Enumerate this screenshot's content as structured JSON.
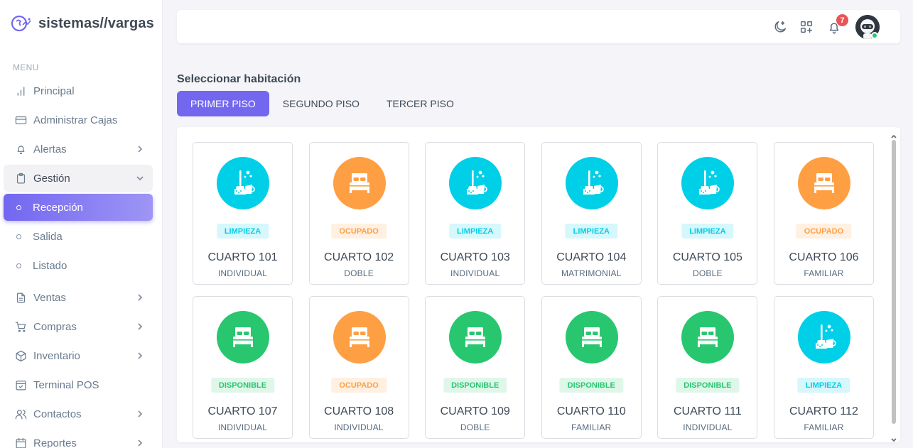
{
  "brand": {
    "name": "sistemas//vargas"
  },
  "sidebar": {
    "header": "MENU",
    "items": [
      {
        "label": "Principal",
        "icon": "bar-chart-icon",
        "chevron": false
      },
      {
        "label": "Administrar Cajas",
        "icon": "credit-card-icon",
        "chevron": false
      },
      {
        "label": "Alertas",
        "icon": "bell-icon",
        "chevron": "right"
      },
      {
        "label": "Gestión",
        "icon": "clipboard-icon",
        "chevron": "down"
      },
      {
        "label": "Recepción",
        "sub": true,
        "active": true
      },
      {
        "label": "Salida",
        "sub": true
      },
      {
        "label": "Listado",
        "sub": true
      },
      {
        "label": "Ventas",
        "icon": "file-text-icon",
        "chevron": "right"
      },
      {
        "label": "Compras",
        "icon": "shopping-cart-icon",
        "chevron": "right"
      },
      {
        "label": "Inventario",
        "icon": "package-icon",
        "chevron": "right"
      },
      {
        "label": "Terminal POS",
        "icon": "calendar-check-icon",
        "chevron": false
      },
      {
        "label": "Contactos",
        "icon": "users-icon",
        "chevron": "right"
      },
      {
        "label": "Reportes",
        "icon": "calendar-icon",
        "chevron": "right"
      }
    ]
  },
  "navbar": {
    "notifications_count": "7",
    "icons": [
      "moon-icon",
      "grid-plus-icon",
      "bell-icon"
    ]
  },
  "main": {
    "title": "Seleccionar habitación",
    "tabs": [
      {
        "label": "PRIMER PISO",
        "active": true
      },
      {
        "label": "SEGUNDO PISO",
        "active": false
      },
      {
        "label": "TERCER PISO",
        "active": false
      }
    ],
    "rooms": [
      {
        "name": "CUARTO 101",
        "type": "INDIVIDUAL",
        "status": "LIMPIEZA"
      },
      {
        "name": "CUARTO 102",
        "type": "DOBLE",
        "status": "OCUPADO"
      },
      {
        "name": "CUARTO 103",
        "type": "INDIVIDUAL",
        "status": "LIMPIEZA"
      },
      {
        "name": "CUARTO 104",
        "type": "MATRIMONIAL",
        "status": "LIMPIEZA"
      },
      {
        "name": "CUARTO 105",
        "type": "DOBLE",
        "status": "LIMPIEZA"
      },
      {
        "name": "CUARTO 106",
        "type": "FAMILIAR",
        "status": "OCUPADO"
      },
      {
        "name": "CUARTO 107",
        "type": "INDIVIDUAL",
        "status": "DISPONIBLE"
      },
      {
        "name": "CUARTO 108",
        "type": "INDIVIDUAL",
        "status": "OCUPADO"
      },
      {
        "name": "CUARTO 109",
        "type": "DOBLE",
        "status": "DISPONIBLE"
      },
      {
        "name": "CUARTO 110",
        "type": "FAMILIAR",
        "status": "DISPONIBLE"
      },
      {
        "name": "CUARTO 111",
        "type": "INDIVIDUAL",
        "status": "DISPONIBLE"
      },
      {
        "name": "CUARTO 112",
        "type": "FAMILIAR",
        "status": "LIMPIEZA"
      }
    ]
  },
  "status_colors": {
    "LIMPIEZA": {
      "circle": "#00cfe8",
      "badge_bg": "#d6f7fb",
      "badge_fg": "#00cfe8"
    },
    "OCUPADO": {
      "circle": "#ff9f43",
      "badge_bg": "#fff0e1",
      "badge_fg": "#ff9f43"
    },
    "DISPONIBLE": {
      "circle": "#28c76f",
      "badge_bg": "#dff7e9",
      "badge_fg": "#28c76f"
    }
  },
  "colors": {
    "accent": "#7367f0"
  }
}
